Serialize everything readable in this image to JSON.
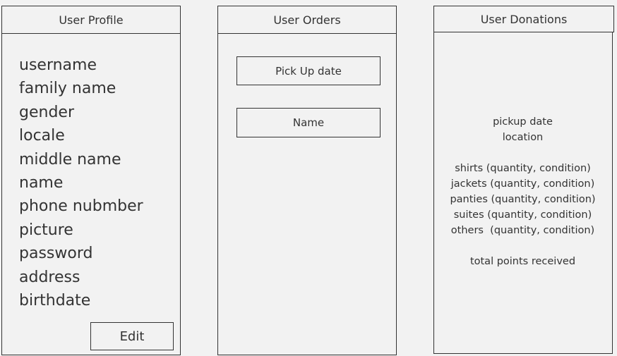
{
  "profile": {
    "title": "User Profile",
    "fields": [
      "username",
      "family name",
      "gender",
      "locale",
      "middle name",
      "name",
      "phone nubmber",
      "picture",
      "password",
      "address",
      "birthdate"
    ],
    "edit_label": "Edit"
  },
  "orders": {
    "title": "User Orders",
    "pickup_label": "Pick Up date",
    "name_label": "Name"
  },
  "donations": {
    "title": "User Donations",
    "pickup_date": "pickup date",
    "location": "location",
    "items": [
      "shirts (quantity, condition)",
      "jackets (quantity, condition)",
      "panties (quantity, condition)",
      "suites (quantity, condition)",
      "others  (quantity, condition)"
    ],
    "total": "total points received"
  }
}
